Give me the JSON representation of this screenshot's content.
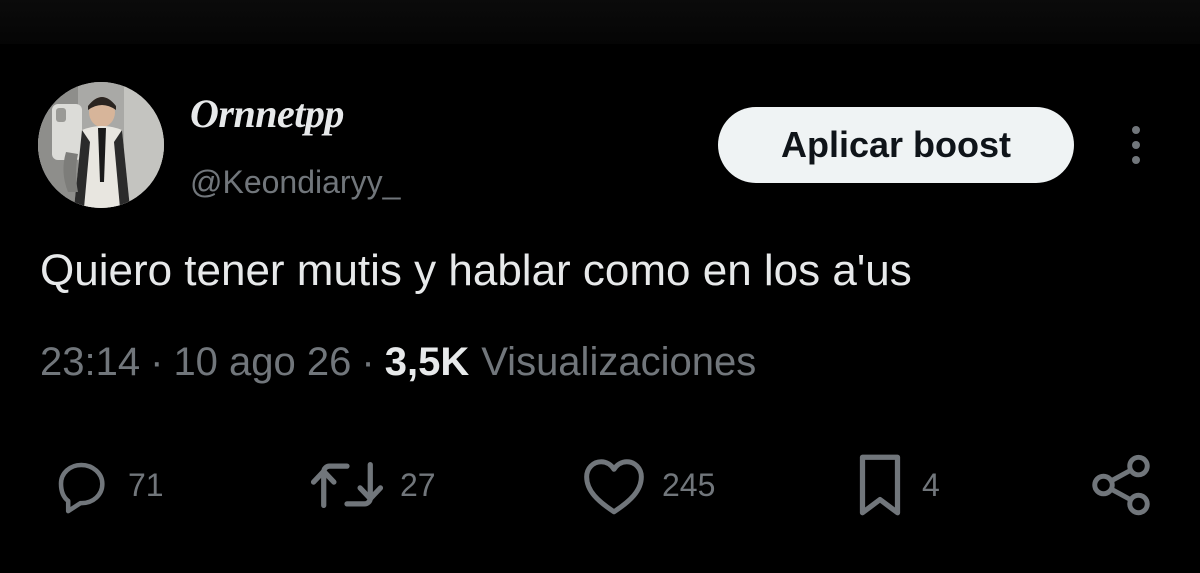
{
  "author": {
    "display_name": "Ornnetpp",
    "handle": "@Keondiaryy_"
  },
  "header": {
    "boost_label": "Aplicar boost",
    "more_icon": "more-vertical-icon"
  },
  "tweet": {
    "text": "Quiero tener mutis y hablar como en los a'us"
  },
  "meta": {
    "time": "23:14",
    "separator": "·",
    "date": "10 ago 26",
    "views_count": "3,5K",
    "views_label": "Visualizaciones"
  },
  "actions": {
    "reply": {
      "icon": "reply-icon",
      "count": "71"
    },
    "retweet": {
      "icon": "retweet-icon",
      "count": "27"
    },
    "like": {
      "icon": "heart-icon",
      "count": "245"
    },
    "bookmark": {
      "icon": "bookmark-icon",
      "count": "4"
    },
    "share": {
      "icon": "share-icon"
    }
  },
  "colors": {
    "background": "#000000",
    "text_primary": "#e7e9ea",
    "text_secondary": "#71767b",
    "button_bg": "#eff3f4",
    "button_text": "#0f1419"
  }
}
